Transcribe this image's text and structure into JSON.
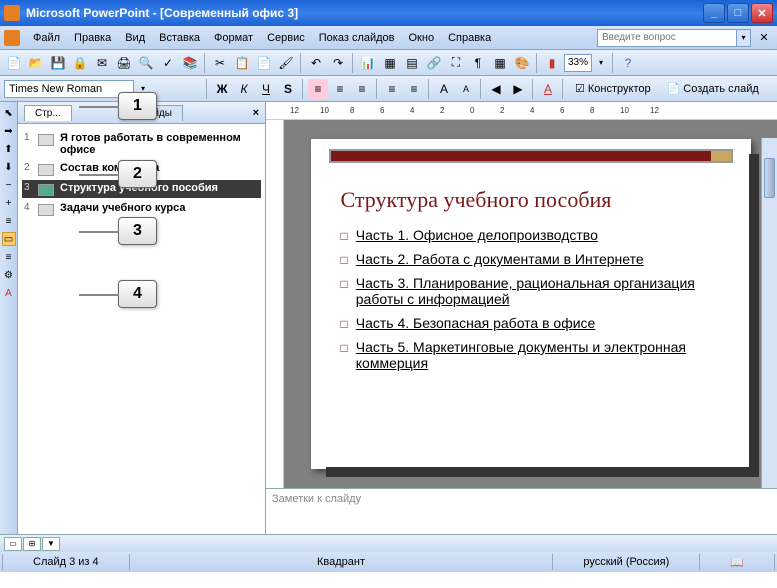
{
  "window": {
    "title": "Microsoft PowerPoint - [Современный офис 3]"
  },
  "menu": {
    "file": "Файл",
    "edit": "Правка",
    "view": "Вид",
    "insert": "Вставка",
    "format": "Формат",
    "service": "Сервис",
    "show": "Показ слайдов",
    "window": "Окно",
    "help": "Справка",
    "ask_placeholder": "Введите вопрос"
  },
  "toolbar": {
    "zoom": "33%",
    "font": "Times New Roman",
    "designer": "Конструктор",
    "newslide": "Создать слайд"
  },
  "tabs": {
    "outline": "Структура",
    "slides": "Слайды"
  },
  "outline": {
    "items": [
      {
        "num": "1",
        "text": "Я готов работать в современном офисе"
      },
      {
        "num": "2",
        "text": "Состав комплекса"
      },
      {
        "num": "3",
        "text": "Структура учебного пособия"
      },
      {
        "num": "4",
        "text": "Задачи учебного курса"
      }
    ]
  },
  "callouts": {
    "c1": "1",
    "c2": "2",
    "c3": "3",
    "c4": "4"
  },
  "slide": {
    "title": "Структура учебного пособия",
    "bullets": [
      "Часть 1. Офисное делопроизводство",
      "Часть 2. Работа с документами в Интернете",
      "Часть 3. Планирование, рациональная организация работы с информацией",
      "Часть 4. Безопасная работа в офисе",
      "Часть 5. Маркетинговые документы и электронная коммерция"
    ]
  },
  "notes": {
    "placeholder": "Заметки к слайду"
  },
  "status": {
    "slide": "Слайд 3 из 4",
    "template": "Квадрант",
    "lang": "русский (Россия)"
  },
  "ruler_ticks": [
    "12",
    "10",
    "8",
    "6",
    "4",
    "2",
    "0",
    "2",
    "4",
    "6",
    "8",
    "10",
    "12"
  ]
}
